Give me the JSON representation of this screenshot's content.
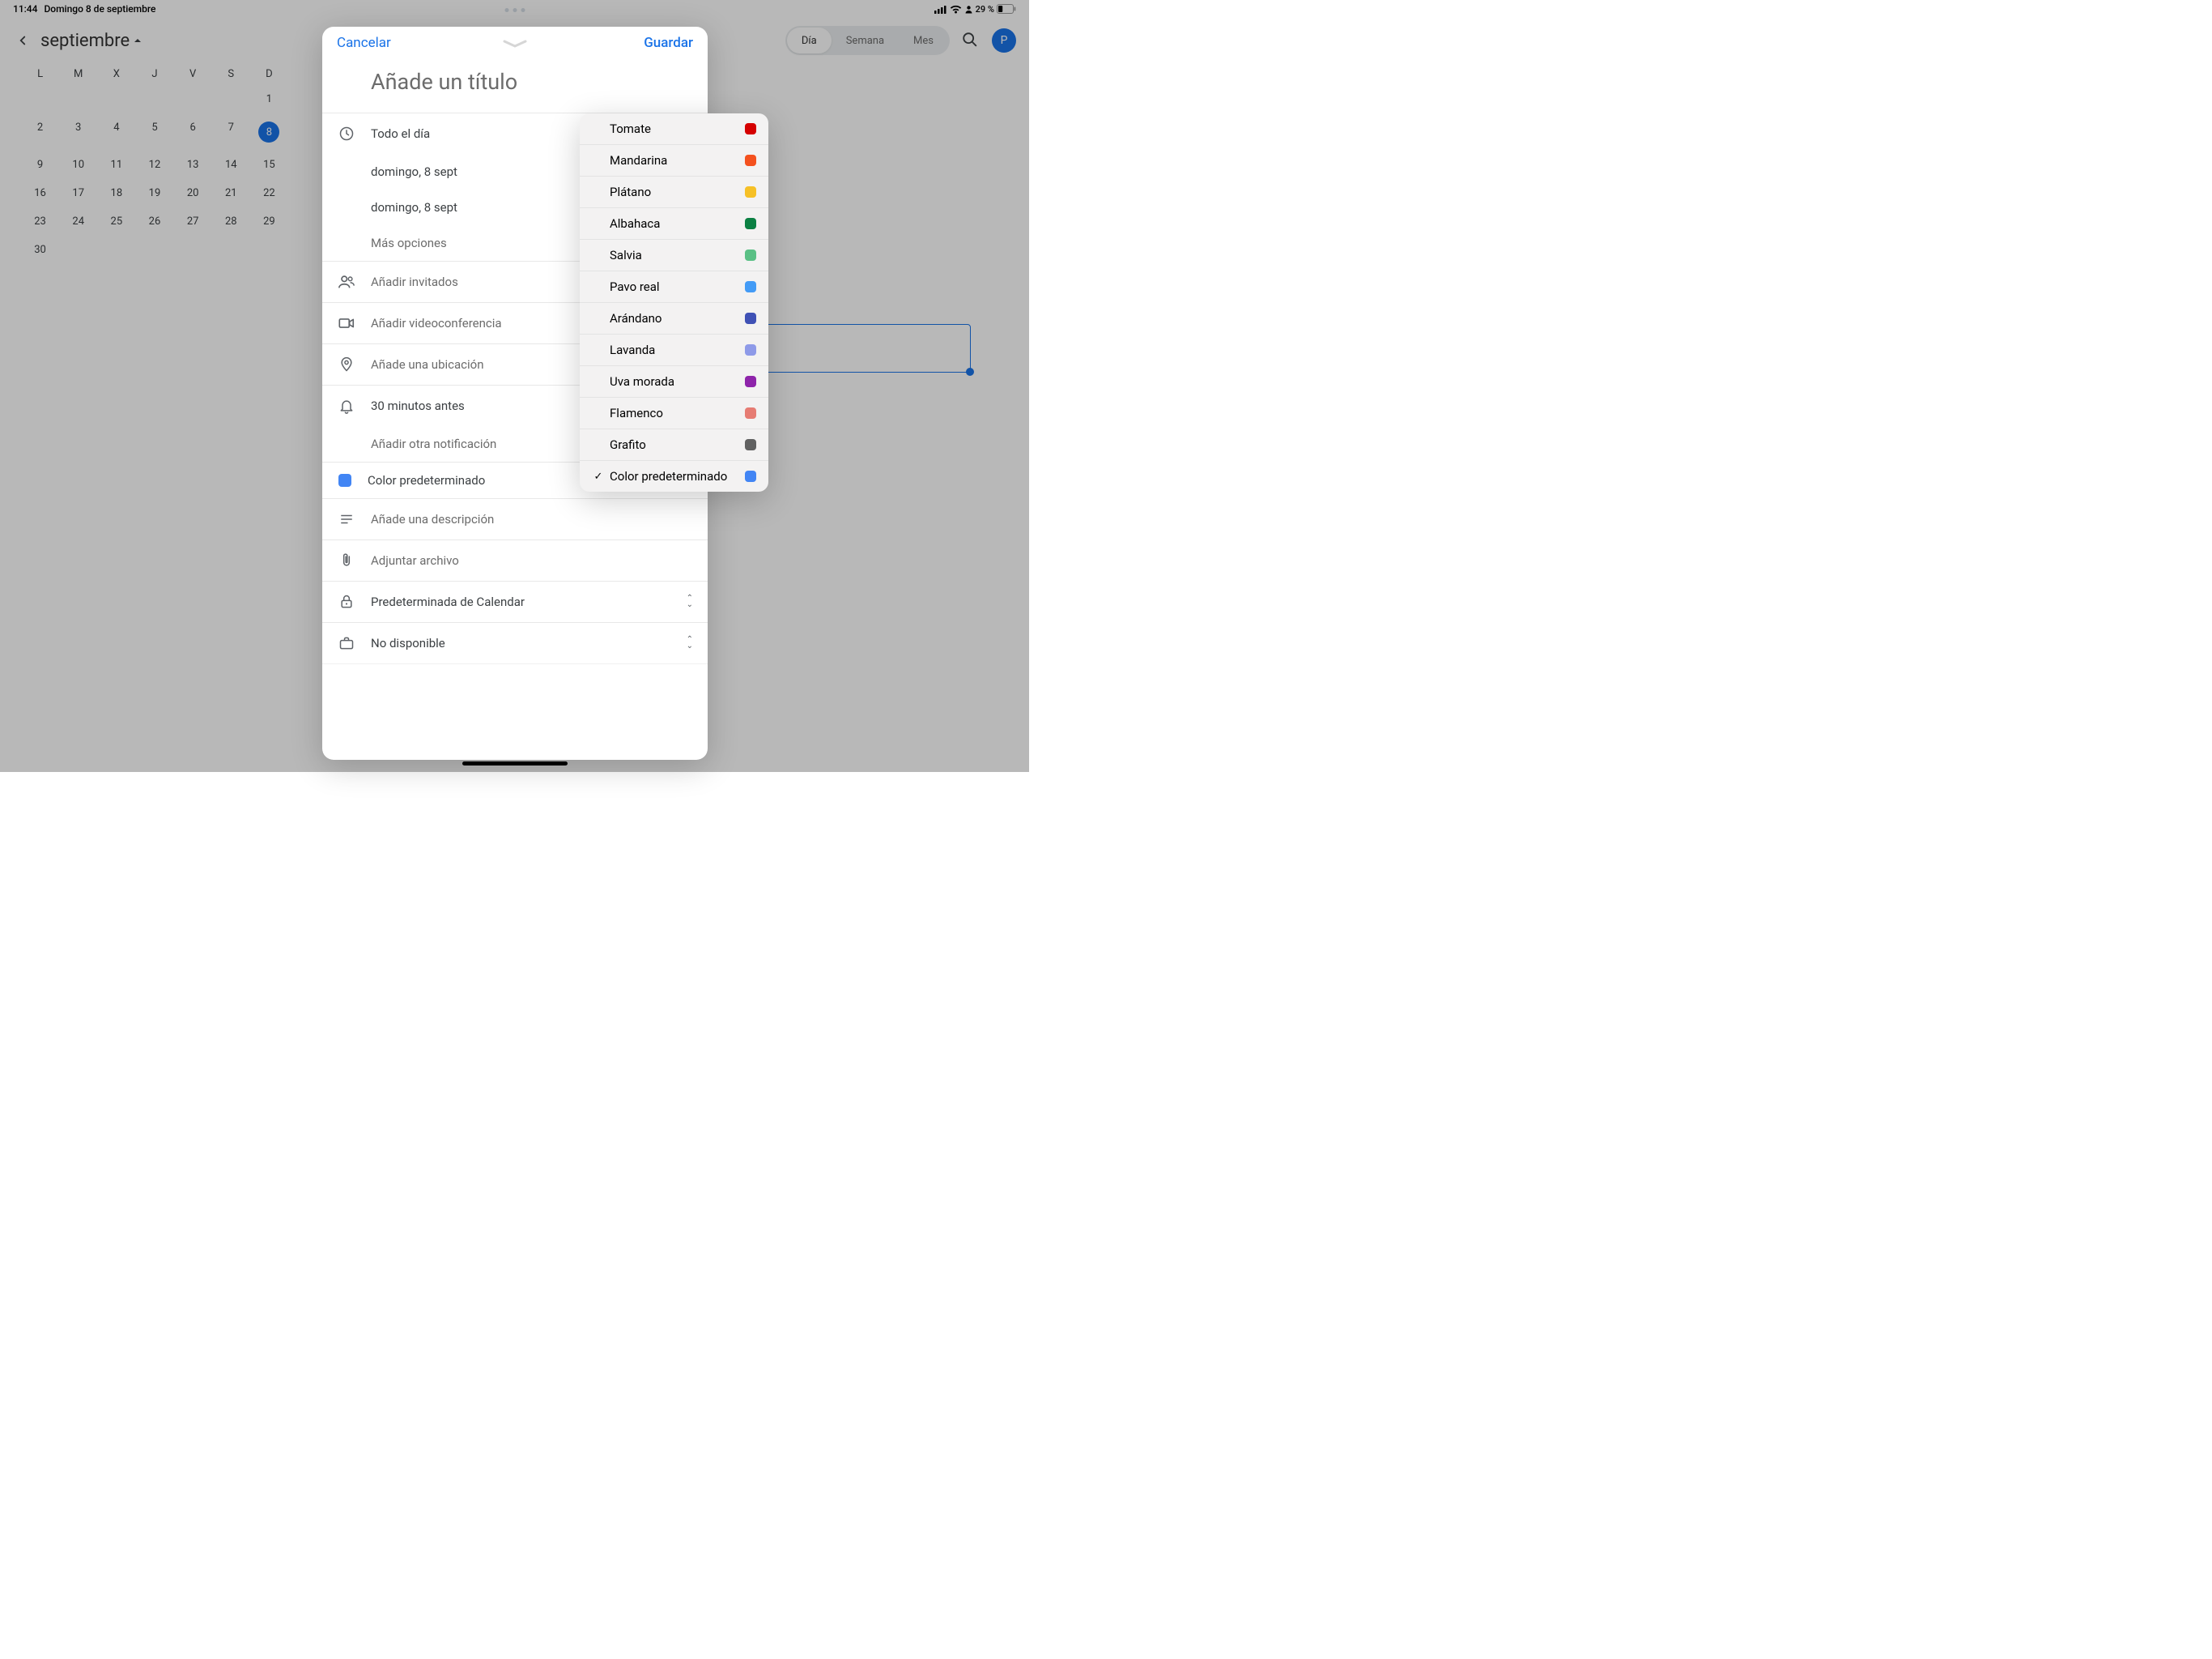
{
  "status": {
    "time": "11:44",
    "date": "Domingo 8 de septiembre",
    "battery": "29 %"
  },
  "top": {
    "month": "septiembre",
    "views": [
      "Día",
      "Semana",
      "Mes"
    ],
    "active_view": "Día",
    "avatar_initial": "P"
  },
  "mini_cal": {
    "dow": [
      "L",
      "M",
      "X",
      "J",
      "V",
      "S",
      "D"
    ],
    "weeks": [
      [
        "",
        "",
        "",
        "",
        "",
        "",
        "1"
      ],
      [
        "2",
        "3",
        "4",
        "5",
        "6",
        "7",
        "8"
      ],
      [
        "9",
        "10",
        "11",
        "12",
        "13",
        "14",
        "15"
      ],
      [
        "16",
        "17",
        "18",
        "19",
        "20",
        "21",
        "22"
      ],
      [
        "23",
        "24",
        "25",
        "26",
        "27",
        "28",
        "29"
      ],
      [
        "30",
        "",
        "",
        "",
        "",
        "",
        ""
      ]
    ],
    "today": "8"
  },
  "modal": {
    "cancel": "Cancelar",
    "save": "Guardar",
    "title_placeholder": "Añade un título",
    "all_day": "Todo el día",
    "start": "domingo, 8 sept",
    "end": "domingo, 8 sept",
    "more_options": "Más opciones",
    "add_guests": "Añadir invitados",
    "add_video": "Añadir videoconferencia",
    "add_location": "Añade una ubicación",
    "reminder": "30 minutos antes",
    "add_notification": "Añadir otra notificación",
    "color_label": "Color predeterminado",
    "add_description": "Añade una descripción",
    "attach_file": "Adjuntar archivo",
    "visibility": "Predeterminada de Calendar",
    "availability": "No disponible"
  },
  "colors": {
    "items": [
      {
        "label": "Tomate",
        "hex": "#d50000"
      },
      {
        "label": "Mandarina",
        "hex": "#f4511e"
      },
      {
        "label": "Plátano",
        "hex": "#f6c026"
      },
      {
        "label": "Albahaca",
        "hex": "#0b8043"
      },
      {
        "label": "Salvia",
        "hex": "#5ac085"
      },
      {
        "label": "Pavo real",
        "hex": "#439bf6"
      },
      {
        "label": "Arándano",
        "hex": "#3f51b5"
      },
      {
        "label": "Lavanda",
        "hex": "#8e9ae8"
      },
      {
        "label": "Uva morada",
        "hex": "#8e24aa"
      },
      {
        "label": "Flamenco",
        "hex": "#e67c73"
      },
      {
        "label": "Grafito",
        "hex": "#616161"
      },
      {
        "label": "Color predeterminado",
        "hex": "#4285f4",
        "selected": true
      }
    ]
  }
}
